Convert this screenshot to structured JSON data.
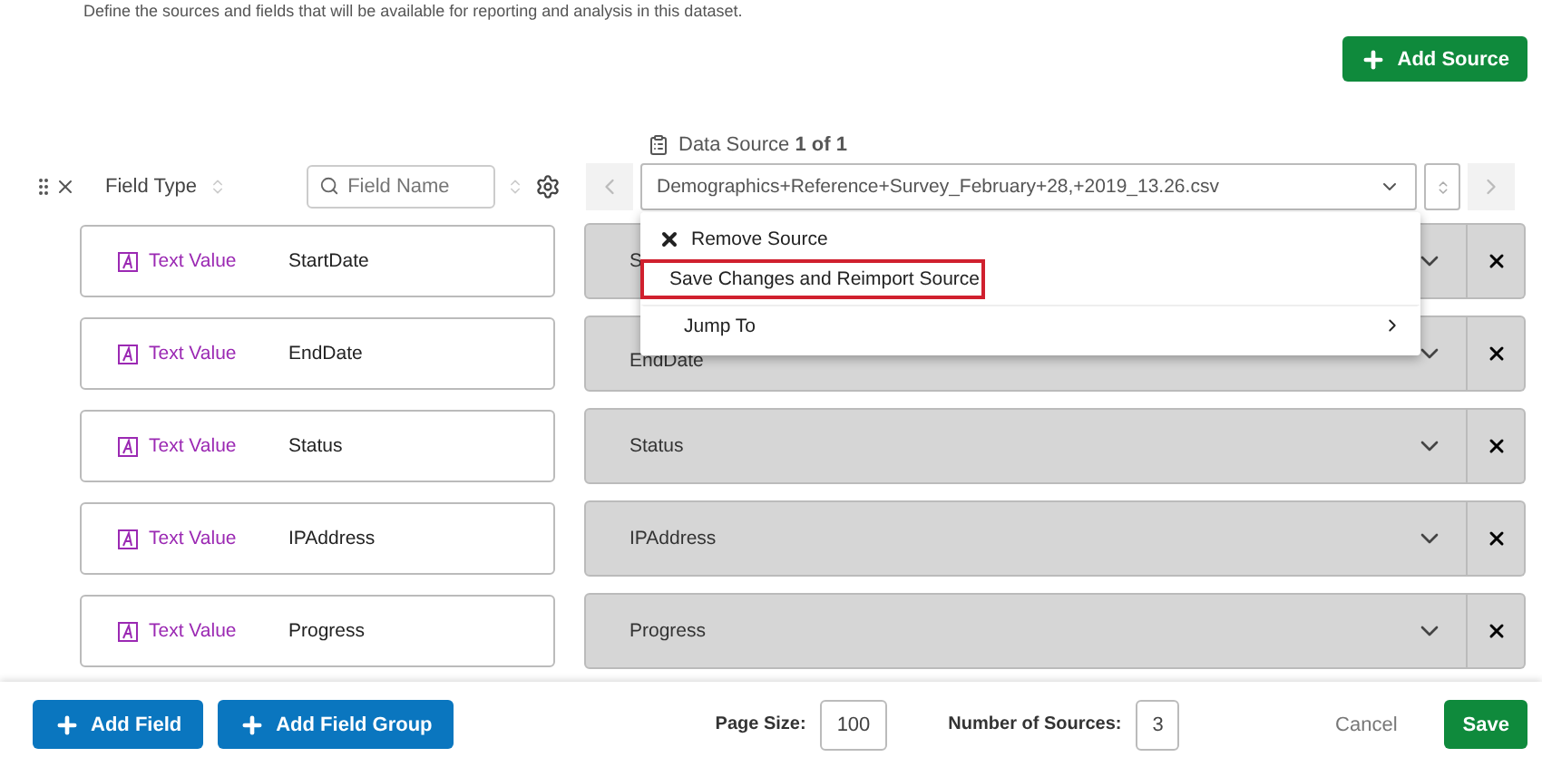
{
  "description": "Define the sources and fields that will be available for reporting and analysis in this dataset.",
  "add_source_button": "Add Source",
  "header": {
    "field_type": "Field Type",
    "field_name_placeholder": "Field Name",
    "data_source_label": "Data Source",
    "data_source_count": "1 of 1",
    "source_file": "Demographics+Reference+Survey_February+28,+2019_13.26.csv"
  },
  "source_menu": {
    "open": true,
    "items": [
      {
        "kind": "remove",
        "label": "Remove Source",
        "highlighted": false
      },
      {
        "kind": "edit",
        "label": "Save Changes and Reimport Source",
        "highlighted": true
      },
      {
        "kind": "submenu",
        "label": "Jump To",
        "highlighted": false
      }
    ]
  },
  "fields": [
    {
      "type": "Text Value",
      "name": "StartDate",
      "mapped": "S"
    },
    {
      "type": "Text Value",
      "name": "EndDate",
      "mapped": "EndDate"
    },
    {
      "type": "Text Value",
      "name": "Status",
      "mapped": "Status"
    },
    {
      "type": "Text Value",
      "name": "IPAddress",
      "mapped": "IPAddress"
    },
    {
      "type": "Text Value",
      "name": "Progress",
      "mapped": "Progress"
    }
  ],
  "footer": {
    "add_field": "Add Field",
    "add_field_group": "Add Field Group",
    "page_size_label": "Page Size:",
    "page_size": "100",
    "sources_label": "Number of Sources:",
    "sources": "3",
    "cancel": "Cancel",
    "save": "Save"
  }
}
